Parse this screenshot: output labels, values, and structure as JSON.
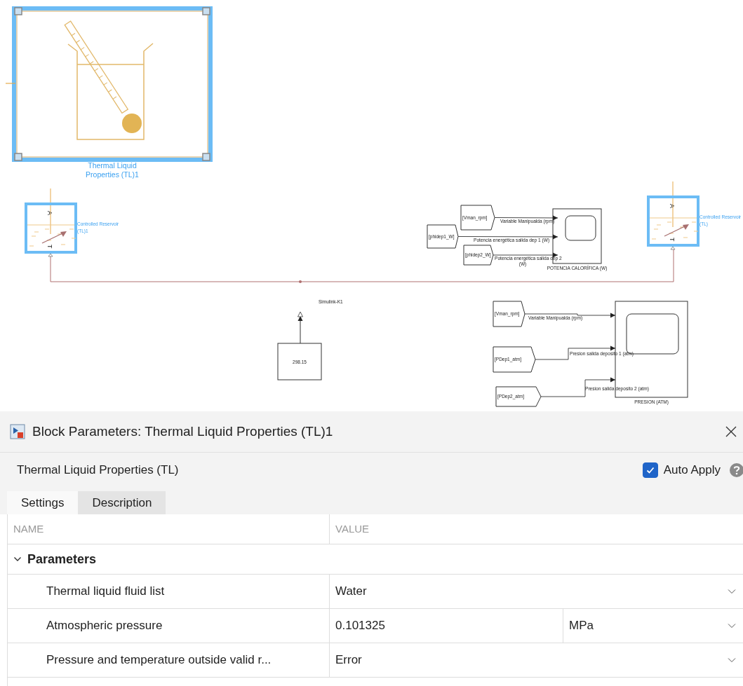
{
  "diagram": {
    "properties_block": {
      "label_lines": [
        "Thermal Liquid",
        "Properties (TL)1"
      ],
      "selected": true
    },
    "reservoirs": [
      {
        "port_top": "A",
        "port_bottom": "T",
        "label_lines": [
          "Controlled Reservoir",
          "(TL)1"
        ],
        "selected": true
      },
      {
        "port_top": "A",
        "port_bottom": "T",
        "label_lines": [
          "Controlled Reservoir",
          "(TL)"
        ],
        "selected": true
      }
    ],
    "constant": {
      "value": "298.15",
      "signal_label": "Simulink-K1"
    },
    "scopes": [
      {
        "name": "POTENCIA CALORÍFICA (W)",
        "inputs": [
          {
            "tag": "[Vman_rpm]",
            "signal_lines": [
              "Variable Manipualda (rpm)"
            ]
          },
          {
            "tag": "[phidep1_W]",
            "signal_lines": [
              "Potencia energética salida dep 1 (W)"
            ]
          },
          {
            "tag": "[phidep2_W]",
            "signal_lines": [
              "Potencia energética salida dep 2",
              "(W)"
            ]
          }
        ]
      },
      {
        "name": "PRESION (ATM)",
        "inputs": [
          {
            "tag": "[Vman_rpm]",
            "signal_lines": [
              "Variable Manipualda (rpm)"
            ]
          },
          {
            "tag": "[PDep1_atm]",
            "signal_lines": [
              "Presion salida deposito 1 (atm)"
            ]
          },
          {
            "tag": "[PDep2_atm]",
            "signal_lines": [
              "Presion salida deposito 2 (atm)"
            ]
          }
        ]
      }
    ]
  },
  "dialog": {
    "title": "Block Parameters: Thermal Liquid Properties (TL)1",
    "block_type": "Thermal Liquid Properties (TL)",
    "auto_apply": {
      "label": "Auto Apply",
      "checked": true
    },
    "tabs": [
      {
        "label": "Settings",
        "selected": true
      },
      {
        "label": "Description",
        "selected": false
      }
    ],
    "columns": [
      "NAME",
      "VALUE"
    ],
    "section": {
      "title": "Parameters",
      "expanded": true
    },
    "rows": [
      {
        "kind": "dropdown",
        "name": "Thermal liquid fluid list",
        "value": "Water"
      },
      {
        "kind": "value_unit",
        "name": "Atmospheric pressure",
        "value": "0.101325",
        "unit": "MPa"
      },
      {
        "kind": "dropdown",
        "name": "Pressure and temperature outside valid r...",
        "value": "Error"
      }
    ]
  }
}
